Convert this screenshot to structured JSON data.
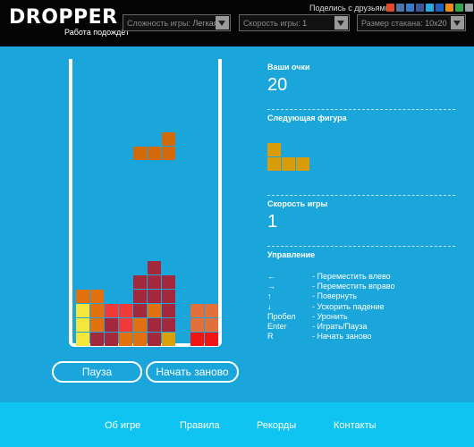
{
  "header": {
    "logo": "DROPPER",
    "logo_sub": "Работа подождёт",
    "share_label": "Поделись с друзьями:",
    "share_icons": [
      {
        "name": "bookmark-icon",
        "color": "#e04a2a"
      },
      {
        "name": "vkontakte-icon",
        "color": "#4a76a8"
      },
      {
        "name": "livejournal-icon",
        "color": "#3a7ac8"
      },
      {
        "name": "facebook-icon",
        "color": "#3b5998"
      },
      {
        "name": "twitter-icon",
        "color": "#2aa9e0"
      },
      {
        "name": "moimir-icon",
        "color": "#1e63c4"
      },
      {
        "name": "odnoklassniki-icon",
        "color": "#f08a1e"
      },
      {
        "name": "google-icon",
        "color": "#2fa84f"
      },
      {
        "name": "link-icon",
        "color": "#9aa0a6"
      },
      {
        "name": "mail-icon",
        "color": "#1e63c4"
      }
    ],
    "difficulty": {
      "label": "Сложность игры:",
      "value": "Легкая"
    },
    "speed": {
      "label": "Скорость игры:",
      "value": "1"
    },
    "size": {
      "label": "Размер стакана:",
      "value": "10x20"
    }
  },
  "buttons": {
    "pause": "Пауза",
    "restart": "Начать заново"
  },
  "score": {
    "label": "Ваши очки",
    "value": "20"
  },
  "next": {
    "label": "Следующая фигура"
  },
  "speed_panel": {
    "label": "Скорость игры",
    "value": "1"
  },
  "controls": {
    "label": "Управление",
    "rows": [
      {
        "key": "←",
        "desc": "- Переместить влево"
      },
      {
        "key": "→",
        "desc": "- Переместить вправо"
      },
      {
        "key": "↑",
        "desc": "- Повернуть"
      },
      {
        "key": "↓",
        "desc": "- Ускорить падение"
      },
      {
        "key": "Пробел",
        "desc": "- Уронить"
      },
      {
        "key": "Enter",
        "desc": "- Играть/Пауза"
      },
      {
        "key": "R",
        "desc": "- Начать заново"
      }
    ]
  },
  "footer": {
    "about": "Об игре",
    "rules": "Правила",
    "records": "Рекорды",
    "contacts": "Контакты"
  },
  "board": {
    "columns": 10,
    "rows": 20,
    "falling_piece": {
      "color": "#d2690a",
      "cells": [
        [
          6,
          5
        ],
        [
          4,
          6
        ],
        [
          5,
          6
        ],
        [
          6,
          6
        ]
      ]
    },
    "cells": [
      {
        "col": 5,
        "row": 14,
        "color": "#a3283b"
      },
      {
        "col": 4,
        "row": 15,
        "color": "#a3283b"
      },
      {
        "col": 5,
        "row": 15,
        "color": "#a3283b"
      },
      {
        "col": 6,
        "row": 15,
        "color": "#a3283b"
      },
      {
        "col": 0,
        "row": 16,
        "color": "#e2700f"
      },
      {
        "col": 1,
        "row": 16,
        "color": "#e2700f"
      },
      {
        "col": 4,
        "row": 16,
        "color": "#a3283b"
      },
      {
        "col": 5,
        "row": 16,
        "color": "#a3283b"
      },
      {
        "col": 6,
        "row": 16,
        "color": "#a3283b"
      },
      {
        "col": 0,
        "row": 17,
        "color": "#f5e63c"
      },
      {
        "col": 1,
        "row": 17,
        "color": "#e2700f"
      },
      {
        "col": 2,
        "row": 17,
        "color": "#f03a3a"
      },
      {
        "col": 3,
        "row": 17,
        "color": "#f03a3a"
      },
      {
        "col": 4,
        "row": 17,
        "color": "#a3283b"
      },
      {
        "col": 5,
        "row": 17,
        "color": "#e2700f"
      },
      {
        "col": 6,
        "row": 17,
        "color": "#a3283b"
      },
      {
        "col": 8,
        "row": 17,
        "color": "#e2703a"
      },
      {
        "col": 9,
        "row": 17,
        "color": "#e2703a"
      },
      {
        "col": 0,
        "row": 18,
        "color": "#f5e63c"
      },
      {
        "col": 1,
        "row": 18,
        "color": "#e2700f"
      },
      {
        "col": 2,
        "row": 18,
        "color": "#a3283b"
      },
      {
        "col": 3,
        "row": 18,
        "color": "#f03a3a"
      },
      {
        "col": 4,
        "row": 18,
        "color": "#e2700f"
      },
      {
        "col": 5,
        "row": 18,
        "color": "#a3283b"
      },
      {
        "col": 6,
        "row": 18,
        "color": "#a3283b"
      },
      {
        "col": 8,
        "row": 18,
        "color": "#e2703a"
      },
      {
        "col": 9,
        "row": 18,
        "color": "#e2703a"
      },
      {
        "col": 0,
        "row": 19,
        "color": "#f5e63c"
      },
      {
        "col": 1,
        "row": 19,
        "color": "#a3283b"
      },
      {
        "col": 2,
        "row": 19,
        "color": "#a3283b"
      },
      {
        "col": 3,
        "row": 19,
        "color": "#e2700f"
      },
      {
        "col": 4,
        "row": 19,
        "color": "#e2700f"
      },
      {
        "col": 5,
        "row": 19,
        "color": "#a3283b"
      },
      {
        "col": 6,
        "row": 19,
        "color": "#d9a00a"
      },
      {
        "col": 8,
        "row": 19,
        "color": "#f01414"
      },
      {
        "col": 9,
        "row": 19,
        "color": "#f01414"
      }
    ]
  },
  "next_piece": {
    "color": "#d99d0a",
    "cells": [
      [
        0,
        0
      ],
      [
        0,
        1
      ],
      [
        1,
        1
      ],
      [
        2,
        1
      ]
    ]
  }
}
